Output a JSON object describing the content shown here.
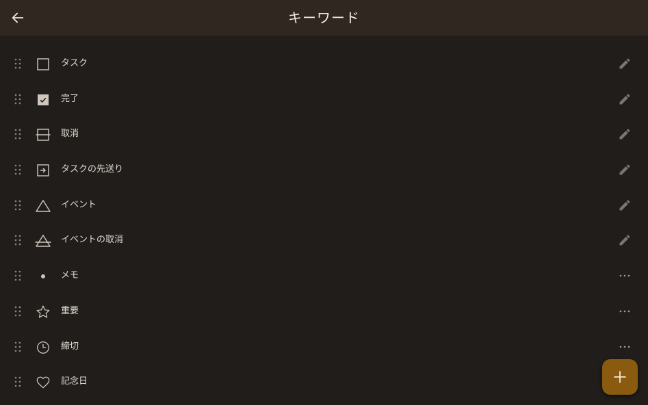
{
  "header": {
    "title": "キーワード",
    "back_icon": "arrow-left-icon"
  },
  "keywords": [
    {
      "label": "タスク",
      "icon": "empty-square-icon",
      "action": "edit-icon"
    },
    {
      "label": "完了",
      "icon": "checked-square-icon",
      "action": "edit-icon"
    },
    {
      "label": "取消",
      "icon": "struck-square-icon",
      "action": "edit-icon"
    },
    {
      "label": "タスクの先送り",
      "icon": "migrate-square-icon",
      "action": "edit-icon"
    },
    {
      "label": "イベント",
      "icon": "triangle-icon",
      "action": "edit-icon"
    },
    {
      "label": "イベントの取消",
      "icon": "struck-triangle-icon",
      "action": "edit-icon"
    },
    {
      "label": "メモ",
      "icon": "dot-icon",
      "action": "more-icon"
    },
    {
      "label": "重要",
      "icon": "star-icon",
      "action": "more-icon"
    },
    {
      "label": "締切",
      "icon": "clock-icon",
      "action": "more-icon"
    },
    {
      "label": "記念日",
      "icon": "heart-icon",
      "action": "more-icon"
    }
  ],
  "fab": {
    "icon": "plus-icon"
  },
  "colors": {
    "background": "#201d1a",
    "header": "#302720",
    "accent": "#8a5a0f",
    "icon": "#cfc7bd"
  }
}
